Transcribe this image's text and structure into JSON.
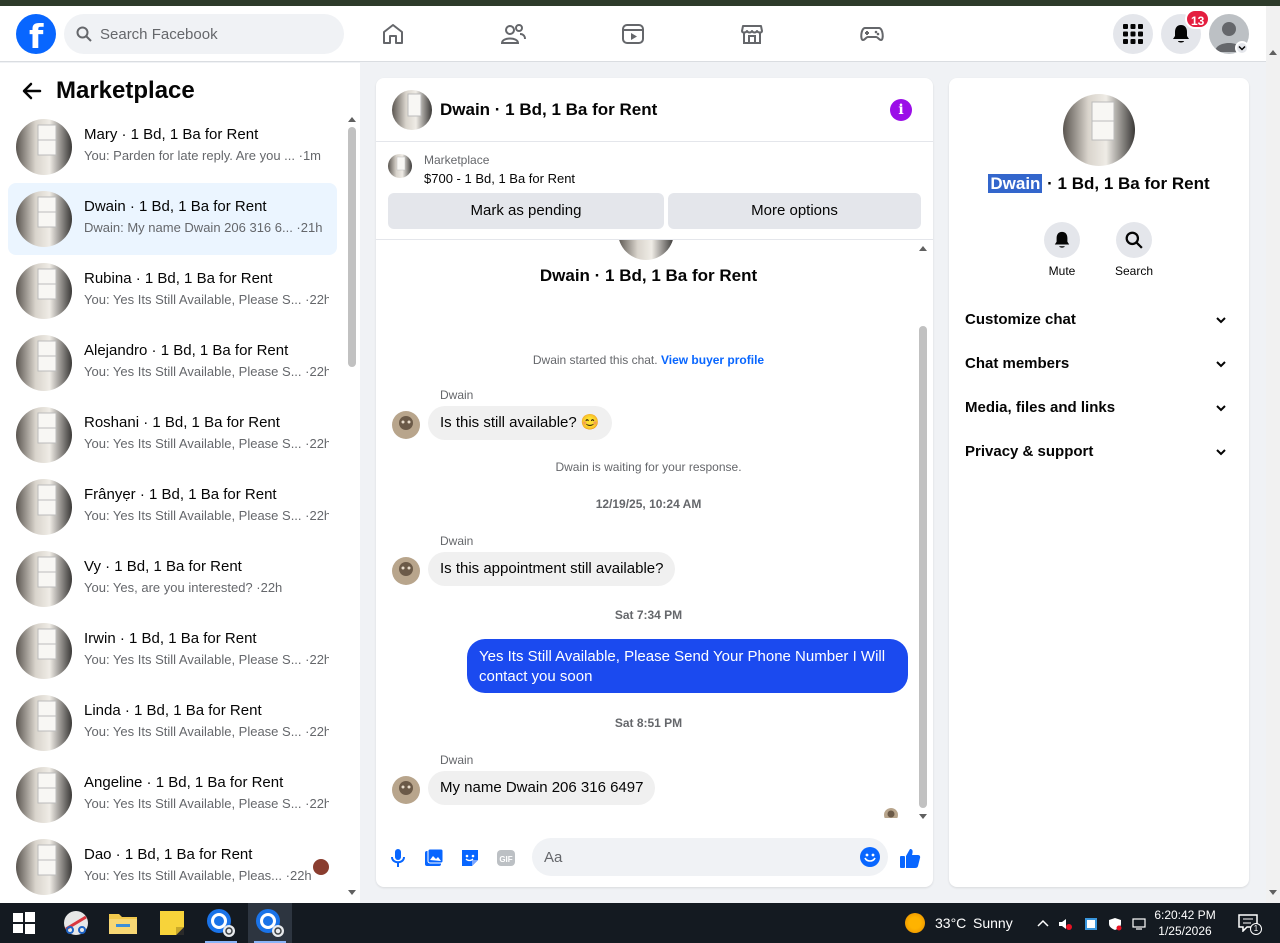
{
  "topbar": {
    "logo": "f",
    "search_placeholder": "Search Facebook",
    "nav_icons": [
      "home-icon",
      "friends-icon",
      "video-icon",
      "marketplace-icon",
      "gaming-icon"
    ],
    "notification_count": "13"
  },
  "left_panel": {
    "title": "Marketplace",
    "conversations": [
      {
        "name": "Mary · 1 Bd, 1 Ba for Rent",
        "preview": "You: Parden for late reply. Are you ... ·1m"
      },
      {
        "name": "Dwain · 1 Bd, 1 Ba for Rent",
        "preview": "Dwain: My name Dwain 206 316 6... ·21h"
      },
      {
        "name": "Rubina · 1 Bd, 1 Ba for Rent",
        "preview": "You: Yes Its Still Available, Please S... ·22h"
      },
      {
        "name": "Alejandro · 1 Bd, 1 Ba for Rent",
        "preview": "You: Yes Its Still Available, Please S... ·22h"
      },
      {
        "name": "Roshani · 1 Bd, 1 Ba for Rent",
        "preview": "You: Yes Its Still Available, Please S... ·22h"
      },
      {
        "name": "Frânyẹr · 1 Bd, 1 Ba for Rent",
        "preview": "You: Yes Its Still Available, Please S... ·22h"
      },
      {
        "name": "Vy · 1 Bd, 1 Ba for Rent",
        "preview": "You: Yes, are you interested? ·22h"
      },
      {
        "name": "Irwin · 1 Bd, 1 Ba for Rent",
        "preview": "You: Yes Its Still Available, Please S... ·22h"
      },
      {
        "name": "Linda · 1 Bd, 1 Ba for Rent",
        "preview": "You: Yes Its Still Available, Please S... ·22h"
      },
      {
        "name": "Angeline · 1 Bd, 1 Ba for Rent",
        "preview": "You: Yes Its Still Available, Please S... ·22h"
      },
      {
        "name": "Dao · 1 Bd, 1 Ba for Rent",
        "preview": "You: Yes Its Still Available, Pleas... ·22h"
      }
    ]
  },
  "chat": {
    "header_title": "Dwain · 1 Bd, 1 Ba for Rent",
    "info_icon": "i",
    "banner_label": "Marketplace",
    "banner_price": "$700 - 1 Bd, 1 Ba for Rent",
    "mark_pending": "Mark as pending",
    "more_options": "More options",
    "listing_title": "Dwain · 1 Bd, 1 Ba for Rent",
    "started_text": "Dwain started this chat.",
    "buyer_profile_link": "View buyer profile",
    "sender": "Dwain",
    "msg1": "Is this still available? 😊",
    "waiting_text": "Dwain is waiting for your response.",
    "ts1": "12/19/25, 10:24 AM",
    "msg2": "Is this appointment still available?",
    "ts2": "Sat 7:34 PM",
    "msg_out": "Yes Its Still Available, Please Send Your Phone Number I Will contact you soon",
    "ts3": "Sat 8:51 PM",
    "msg3": "My name Dwain 206 316 6497",
    "composer_placeholder": "Aa"
  },
  "right_panel": {
    "title_highlight": "Dwain",
    "title_rest": " · 1 Bd, 1 Ba for Rent",
    "mute_label": "Mute",
    "search_label": "Search",
    "sections": [
      "Customize chat",
      "Chat members",
      "Media, files and links",
      "Privacy & support"
    ]
  },
  "taskbar": {
    "weather_temp": "33°C",
    "weather_desc": "Sunny",
    "time": "6:20:42 PM",
    "date": "1/25/2026",
    "notif_count": "1"
  },
  "colors": {
    "brand_blue": "#0866ff",
    "outgoing_bubble": "#1b4aef",
    "active_row": "#ebf5ff",
    "info_purple": "#9b0ee8",
    "badge_red": "#e41e3f"
  }
}
